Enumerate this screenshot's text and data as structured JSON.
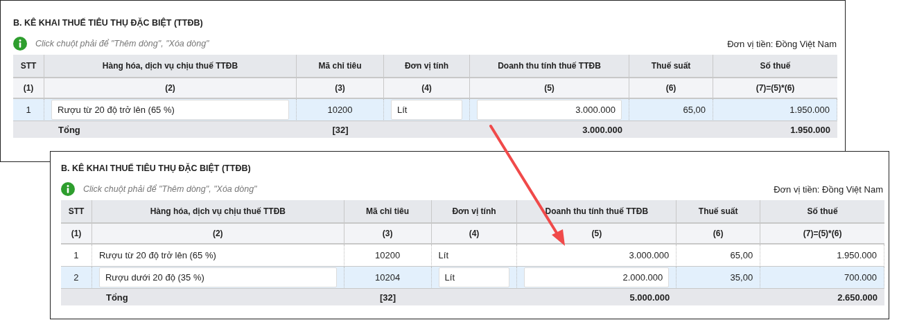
{
  "panels": [
    {
      "title": "B. KÊ KHAI THUẾ TIÊU THỤ ĐẶC BIỆT (TTĐB)",
      "hint": "Click chuột phải để \"Thêm dòng\", \"Xóa dòng\"",
      "currency": "Đơn vị tiền: Đồng Việt Nam",
      "columns": [
        "STT",
        "Hàng hóa, dịch vụ chịu thuế TTĐB",
        "Mã chỉ tiêu",
        "Đơn vị tính",
        "Doanh thu tính thuế TTĐB",
        "Thuế suất",
        "Số thuế"
      ],
      "column_numbers": [
        "(1)",
        "(2)",
        "(3)",
        "(4)",
        "(5)",
        "(6)",
        "(7)=(5)*(6)"
      ],
      "rows": [
        {
          "stt": "1",
          "item": "Rượu từ 20 độ trở lên (65 %)",
          "code": "10200",
          "unit": "Lít",
          "revenue": "3.000.000",
          "rate": "65,00",
          "tax": "1.950.000",
          "selected": true
        }
      ],
      "total": {
        "label": "Tổng",
        "code": "[32]",
        "revenue": "3.000.000",
        "tax": "1.950.000"
      }
    },
    {
      "title": "B. KÊ KHAI THUẾ TIÊU THỤ ĐẶC BIỆT (TTĐB)",
      "hint": "Click chuột phải để \"Thêm dòng\", \"Xóa dòng\"",
      "currency": "Đơn vị tiền: Đồng Việt Nam",
      "columns": [
        "STT",
        "Hàng hóa, dịch vụ chịu thuế TTĐB",
        "Mã chỉ tiêu",
        "Đơn vị tính",
        "Doanh thu tính thuế TTĐB",
        "Thuế suất",
        "Số thuế"
      ],
      "column_numbers": [
        "(1)",
        "(2)",
        "(3)",
        "(4)",
        "(5)",
        "(6)",
        "(7)=(5)*(6)"
      ],
      "rows": [
        {
          "stt": "1",
          "item": "Rượu từ 20 độ trở lên (65 %)",
          "code": "10200",
          "unit": "Lít",
          "revenue": "3.000.000",
          "rate": "65,00",
          "tax": "1.950.000",
          "selected": false
        },
        {
          "stt": "2",
          "item": "Rượu dưới 20 độ (35 %)",
          "code": "10204",
          "unit": "Lít",
          "revenue": "2.000.000",
          "rate": "35,00",
          "tax": "700.000",
          "selected": true
        }
      ],
      "total": {
        "label": "Tổng",
        "code": "[32]",
        "revenue": "5.000.000",
        "tax": "2.650.000"
      }
    }
  ]
}
